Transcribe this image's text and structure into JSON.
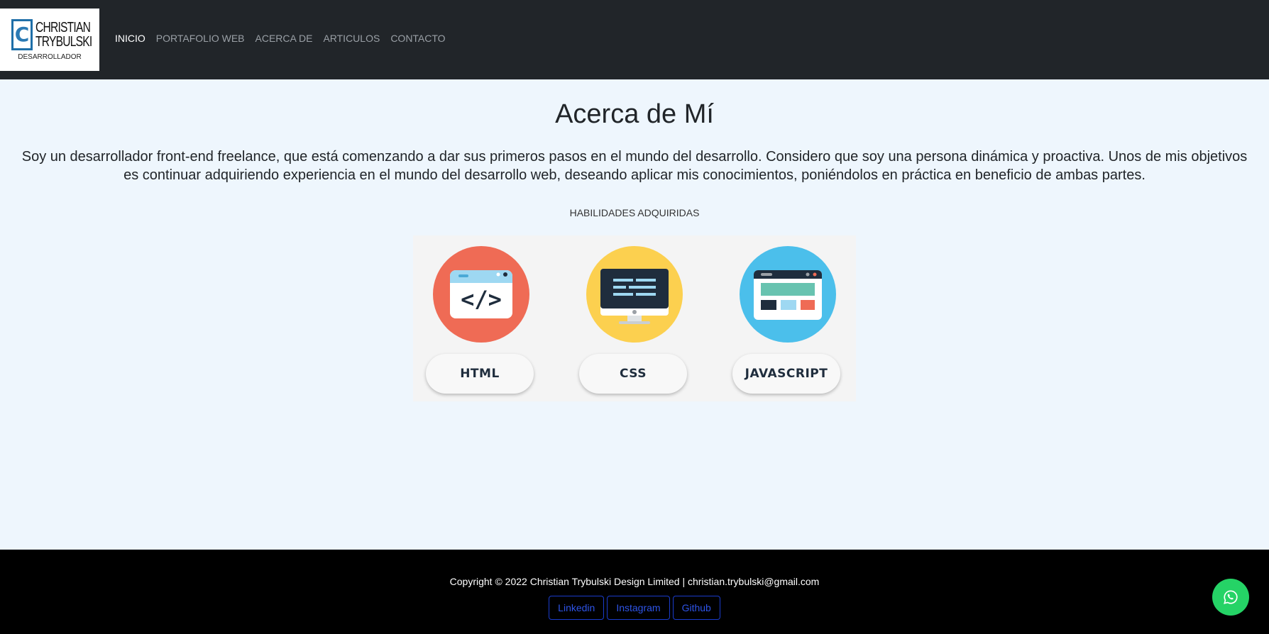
{
  "header": {
    "logo": {
      "letter": "C",
      "name_line1": "CHRISTIAN",
      "name_line2": "TRYBULSKI",
      "subtitle": "DESARROLLADOR"
    },
    "nav": [
      {
        "label": "INICIO",
        "active": true
      },
      {
        "label": "PORTAFOLIO WEB",
        "active": false
      },
      {
        "label": "ACERCA DE",
        "active": false
      },
      {
        "label": "ARTICULOS",
        "active": false
      },
      {
        "label": "CONTACTO",
        "active": false
      }
    ]
  },
  "main": {
    "title": "Acerca de Mí",
    "about_text": "Soy un desarrollador front-end freelance, que está comenzando a dar sus primeros pasos en el mundo del desarrollo. Considero que soy una persona dinámica y proactiva. Unos de mis objetivos es continuar adquiriendo experiencia en el mundo del desarrollo web, deseando aplicar mis conocimientos, poniéndolos en práctica en beneficio de ambas partes.",
    "skills_heading": "HABILIDADES ADQUIRIDAS",
    "skills": [
      {
        "label": "HTML",
        "icon": "html-code-window-icon",
        "color": "#ef6b55"
      },
      {
        "label": "CSS",
        "icon": "monitor-icon",
        "color": "#fcd04f"
      },
      {
        "label": "JAVASCRIPT",
        "icon": "browser-layout-icon",
        "color": "#4bbfeb"
      }
    ]
  },
  "footer": {
    "copyright": "Copyright © 2022 Christian Trybulski Design Limited | christian.trybulski@gmail.com",
    "social": [
      {
        "label": "Linkedin"
      },
      {
        "label": "Instagram"
      },
      {
        "label": "Github"
      }
    ],
    "whatsapp_icon": "whatsapp-icon"
  },
  "colors": {
    "navbar": "#212529",
    "body": "#eef6fd",
    "footer": "#000000",
    "link": "#2e54e8",
    "whatsapp": "#25d366"
  }
}
